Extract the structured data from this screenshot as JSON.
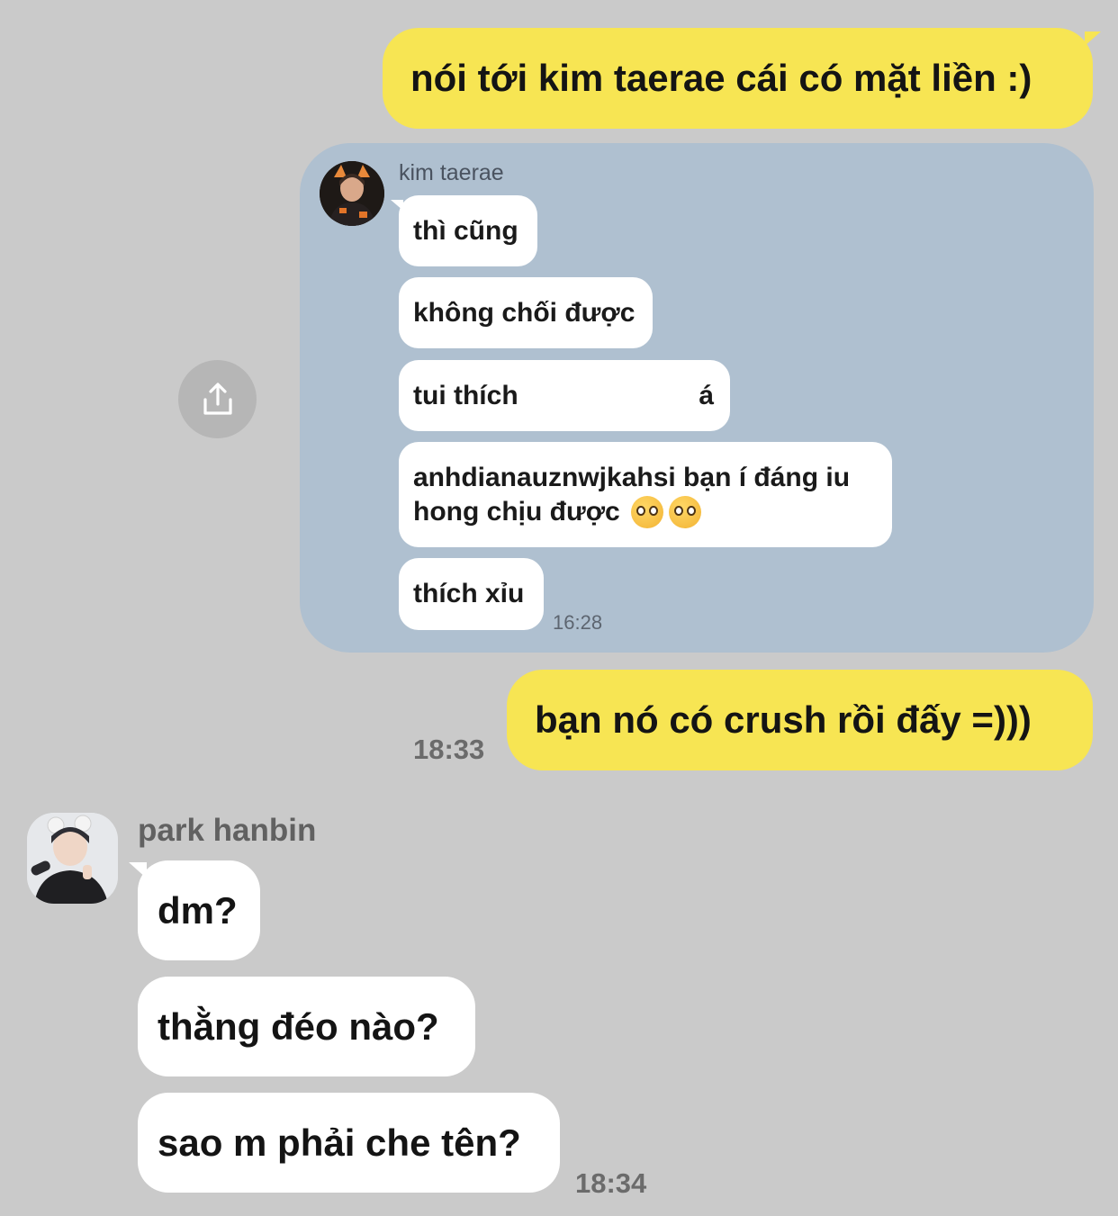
{
  "messages_outgoing": [
    {
      "text": "nói tới kim taerae cái có mặt liền :)"
    },
    {
      "text": "bạn nó có crush rồi đấy =)))",
      "time": "18:33"
    }
  ],
  "forwarded": {
    "sender": "kim taerae",
    "time": "16:28",
    "messages": [
      {
        "text": "thì cũng"
      },
      {
        "text": "không chối được"
      },
      {
        "text": "tui thích",
        "trailing": "á"
      },
      {
        "line1": "anhdianauznwjkahsi bạn í đáng iu",
        "line2": "hong chịu được"
      },
      {
        "text": "thích xỉu"
      }
    ]
  },
  "share_button": {
    "icon": "share-icon"
  },
  "incoming": {
    "sender": "park hanbin",
    "time": "18:34",
    "messages": [
      {
        "text": "dm?"
      },
      {
        "text": "thằng đéo nào?"
      },
      {
        "text": "sao m phải che tên?"
      }
    ]
  },
  "colors": {
    "background": "#cacaca",
    "outgoing_bubble": "#f7e553",
    "forward_card": "#afc0d0",
    "incoming_bubble": "#ffffff"
  }
}
